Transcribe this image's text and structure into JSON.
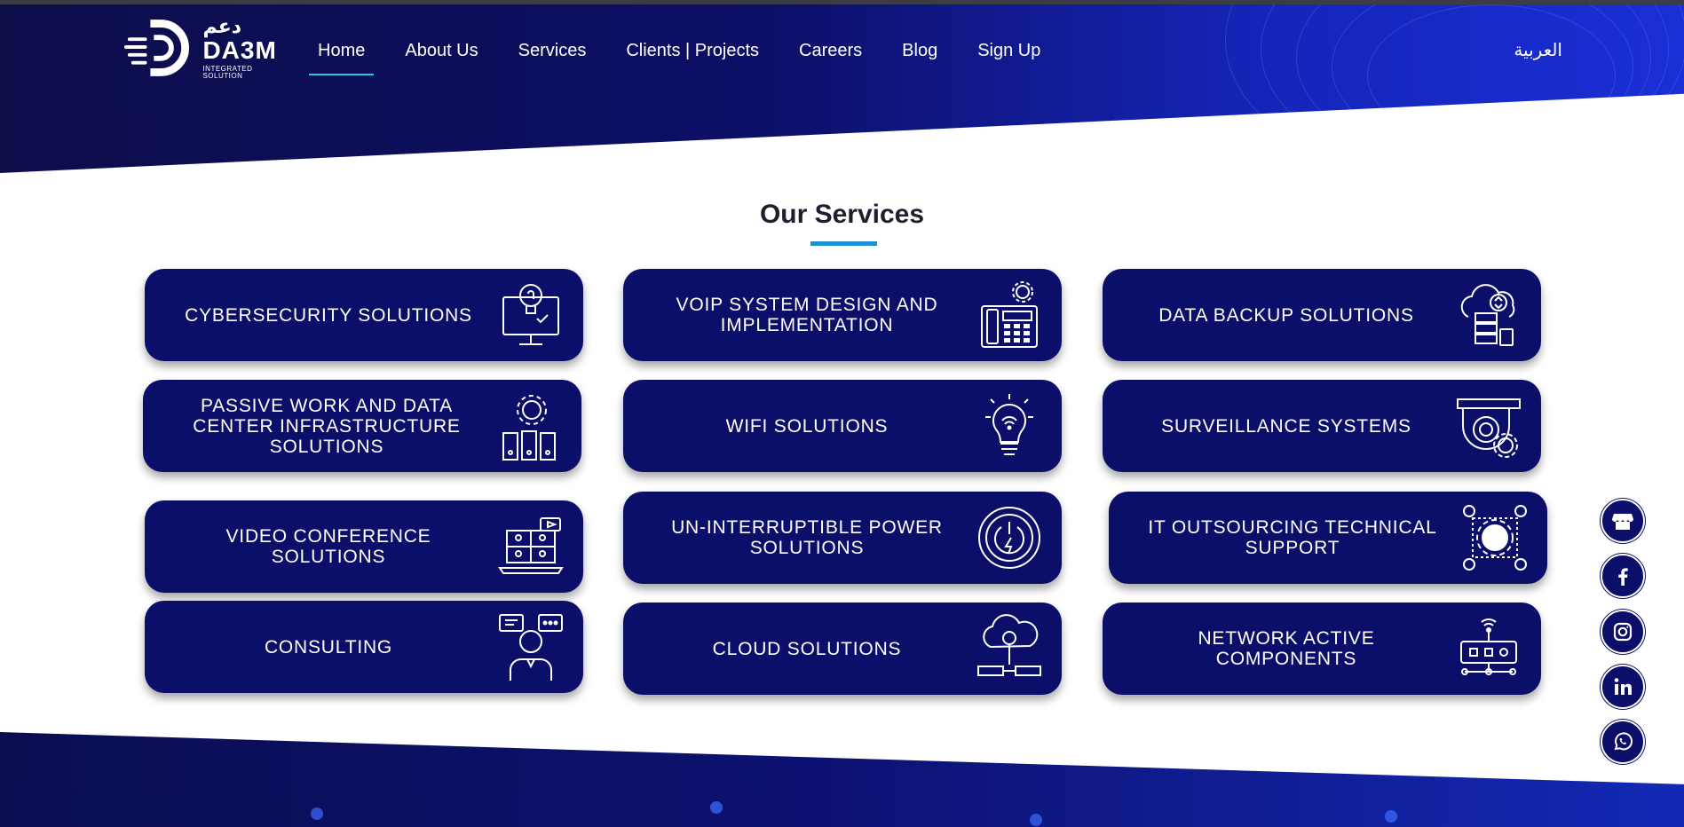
{
  "brand": {
    "name_ar": "دعم",
    "name_en": "DA3M",
    "tagline": "INTEGRATED SOLUTION"
  },
  "nav": {
    "items": [
      {
        "label": "Home",
        "active": true
      },
      {
        "label": "About Us"
      },
      {
        "label": "Services"
      },
      {
        "label": "Clients | Projects"
      },
      {
        "label": "Careers"
      },
      {
        "label": "Blog"
      },
      {
        "label": "Sign Up"
      }
    ],
    "language": "العربية"
  },
  "services": {
    "title": "Our Services",
    "items": [
      {
        "label": "CYBERSECURITY SOLUTIONS",
        "icon": "monitor-lightbulb-icon"
      },
      {
        "label": "VOIP SYSTEM DESIGN AND IMPLEMENTATION",
        "icon": "voip-phone-icon"
      },
      {
        "label": "DATA BACKUP SOLUTIONS",
        "icon": "cloud-backup-icon"
      },
      {
        "label": "PASSIVE WORK AND DATA CENTER INFRASTRUCTURE SOLUTIONS",
        "icon": "server-gear-icon"
      },
      {
        "label": "WIFI SOLUTIONS",
        "icon": "wifi-bulb-icon"
      },
      {
        "label": "SURVEILLANCE SYSTEMS",
        "icon": "camera-gear-icon"
      },
      {
        "label": "VIDEO CONFERENCE SOLUTIONS",
        "icon": "laptop-conference-icon"
      },
      {
        "label": "UN-INTERRUPTIBLE POWER SOLUTIONS",
        "icon": "power-icon"
      },
      {
        "label": "IT OUTSOURCING TECHNICAL SUPPORT",
        "icon": "globe-gear-users-icon"
      },
      {
        "label": "CONSULTING",
        "icon": "consultant-icon"
      },
      {
        "label": "CLOUD SOLUTIONS",
        "icon": "cloud-network-icon"
      },
      {
        "label": "NETWORK ACTIVE COMPONENTS",
        "icon": "network-router-icon"
      }
    ]
  },
  "social": [
    "store-icon",
    "facebook-icon",
    "instagram-icon",
    "linkedin-icon",
    "whatsapp-icon"
  ],
  "colors": {
    "card": "#0c0f6a",
    "accent": "#1e8fd1",
    "nav_underline": "#2ec4e8"
  }
}
